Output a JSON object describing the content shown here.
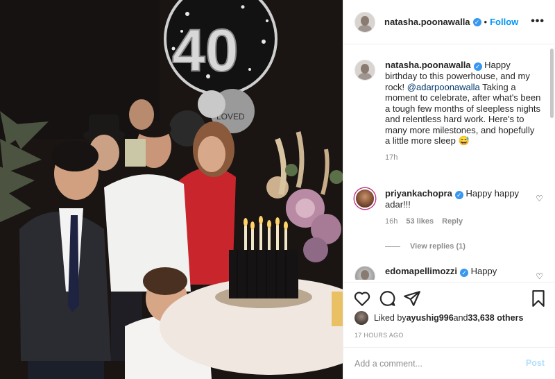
{
  "photo": {
    "description_icon": "party-photo",
    "balloon_number": "40",
    "balloon_small_text": "LOVED"
  },
  "header": {
    "username": "natasha.poonawalla",
    "verified_icon": "verified-badge-icon",
    "separator": "•",
    "follow_label": "Follow",
    "more_icon": "more-options-icon",
    "more_glyph": "•••"
  },
  "caption": {
    "username": "natasha.poonawalla",
    "text_before_mention": " Happy birthday to this powerhouse, and my rock! ",
    "mention": "@adarpoonawalla",
    "text_after_mention": " Taking a moment to celebrate, after what's been a tough few months of sleepless nights and relentless hard work. Here's to many more milestones, and hopefully a little more sleep 😅",
    "time": "17h"
  },
  "comments": [
    {
      "username": "priyankachopra",
      "text": " Happy happy adar!!!",
      "time": "16h",
      "likes": "53 likes",
      "reply_label": "Reply",
      "view_replies": "View replies (1)"
    },
    {
      "username": "edomapellimozzi",
      "text": " Happy"
    }
  ],
  "actions": {
    "like_icon": "heart-icon",
    "comment_icon": "comment-icon",
    "share_icon": "share-icon",
    "save_icon": "bookmark-icon"
  },
  "likes": {
    "prefix": "Liked by ",
    "first_user": "ayushig996",
    "middle": " and ",
    "others": "33,638 others"
  },
  "post_time": "17 HOURS AGO",
  "add_comment": {
    "placeholder": "Add a comment...",
    "post_label": "Post"
  },
  "colors": {
    "link": "#0095f6",
    "verified": "#3897f0",
    "post_disabled": "#b2dffc",
    "muted": "#8e8e8e"
  }
}
